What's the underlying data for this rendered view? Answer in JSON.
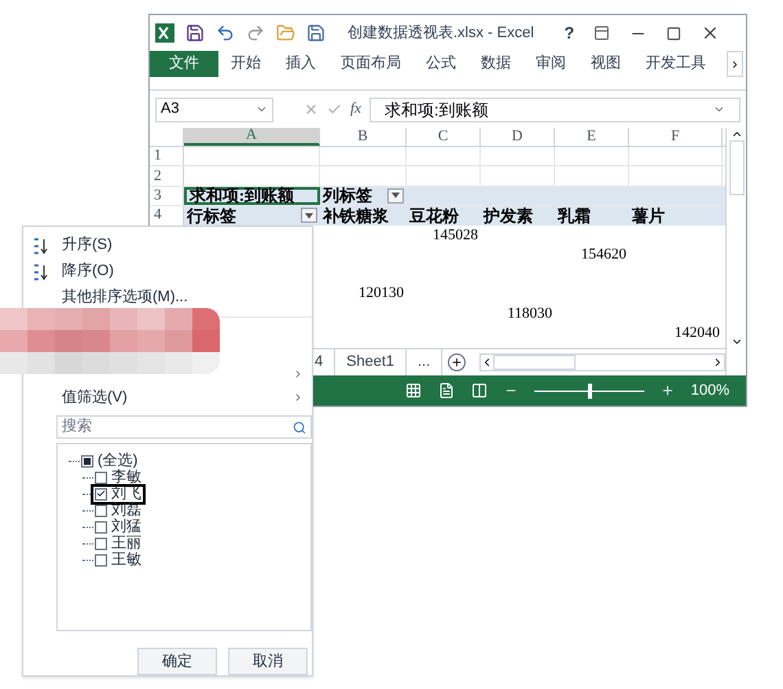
{
  "window": {
    "title": "创建数据透视表.xlsx - Excel",
    "help": "?"
  },
  "ribbon_tabs": [
    {
      "label": "文件",
      "selected": true
    },
    {
      "label": "开始",
      "selected": false
    },
    {
      "label": "插入",
      "selected": false
    },
    {
      "label": "页面布局",
      "selected": false
    },
    {
      "label": "公式",
      "selected": false
    },
    {
      "label": "数据",
      "selected": false
    },
    {
      "label": "审阅",
      "selected": false
    },
    {
      "label": "视图",
      "selected": false
    },
    {
      "label": "开发工具",
      "selected": false
    }
  ],
  "formula_bar": {
    "name_box": "A3",
    "fx": "fx",
    "content": "求和项:到账额"
  },
  "columns": [
    {
      "label": "A",
      "selected": true
    },
    {
      "label": "B",
      "selected": false
    },
    {
      "label": "C",
      "selected": false
    },
    {
      "label": "D",
      "selected": false
    },
    {
      "label": "E",
      "selected": false
    },
    {
      "label": "F",
      "selected": false
    }
  ],
  "rows": [
    {
      "number": "1",
      "kind": "data",
      "cells": []
    },
    {
      "number": "2",
      "kind": "data",
      "cells": []
    },
    {
      "number": "3",
      "kind": "header",
      "cells": [
        {
          "text": "求和项:到账额",
          "selected": true,
          "dropdown": false
        },
        {
          "text": "列标签",
          "selected": false,
          "dropdown": true
        },
        null,
        null,
        null,
        null
      ]
    },
    {
      "number": "4",
      "kind": "header",
      "cells": [
        {
          "text": "行标签",
          "selected": false,
          "dropdown": true
        },
        {
          "text": "补铁糖浆",
          "selected": false,
          "dropdown": false
        },
        {
          "text": "豆花粉",
          "selected": false,
          "dropdown": false
        },
        {
          "text": "护发素",
          "selected": false,
          "dropdown": false
        },
        {
          "text": "乳霜",
          "selected": false,
          "dropdown": false
        },
        {
          "text": "薯片",
          "selected": false,
          "dropdown": false
        }
      ]
    },
    {
      "kind": "data",
      "cells": [
        null,
        null,
        {
          "text": "145028",
          "selected": false,
          "dropdown": false
        },
        null,
        null,
        null
      ]
    },
    {
      "kind": "data",
      "cells": [
        null,
        null,
        null,
        null,
        {
          "text": "154620",
          "selected": false,
          "dropdown": false
        },
        null
      ]
    },
    {
      "kind": "data",
      "cells": []
    },
    {
      "kind": "data",
      "cells": [
        null,
        {
          "text": "120130",
          "selected": false,
          "dropdown": false
        },
        null,
        null,
        null,
        null
      ]
    },
    {
      "kind": "data",
      "cells": [
        null,
        null,
        null,
        {
          "text": "118030",
          "selected": false,
          "dropdown": false
        },
        null,
        null
      ]
    },
    {
      "kind": "data",
      "cells": [
        null,
        null,
        null,
        null,
        null,
        {
          "text": "142040",
          "selected": false,
          "dropdown": false
        }
      ]
    }
  ],
  "sheet_tabs": [
    {
      "label": "4"
    },
    {
      "label": "Sheet1"
    },
    {
      "label": "..."
    }
  ],
  "status_bar": {
    "zoom": {
      "level": 0.5,
      "reading": "100%"
    }
  },
  "filter_menu": {
    "sort_items": [
      {
        "label": "升序(S)",
        "kind": "ascending"
      },
      {
        "label": "降序(O)",
        "kind": "descending"
      },
      {
        "label": "其他排序选项(M)...",
        "kind": "plain"
      }
    ],
    "filter_items": [
      {
        "label": "值筛选(V)",
        "submenu": true
      }
    ],
    "search": {
      "placeholder": "搜索"
    },
    "tree": {
      "label": "(全选)",
      "partial": true,
      "focused": false,
      "children": [
        {
          "label": "李敏",
          "checked": false,
          "focused": false
        },
        {
          "label": "刘飞",
          "checked": true,
          "focused": true
        },
        {
          "label": "刘磊",
          "checked": false,
          "focused": false
        },
        {
          "label": "刘猛",
          "checked": false,
          "focused": false
        },
        {
          "label": "王丽",
          "checked": false,
          "focused": false
        },
        {
          "label": "王敏",
          "checked": false,
          "focused": false
        }
      ]
    },
    "buttons": [
      "确定",
      "取消"
    ]
  }
}
